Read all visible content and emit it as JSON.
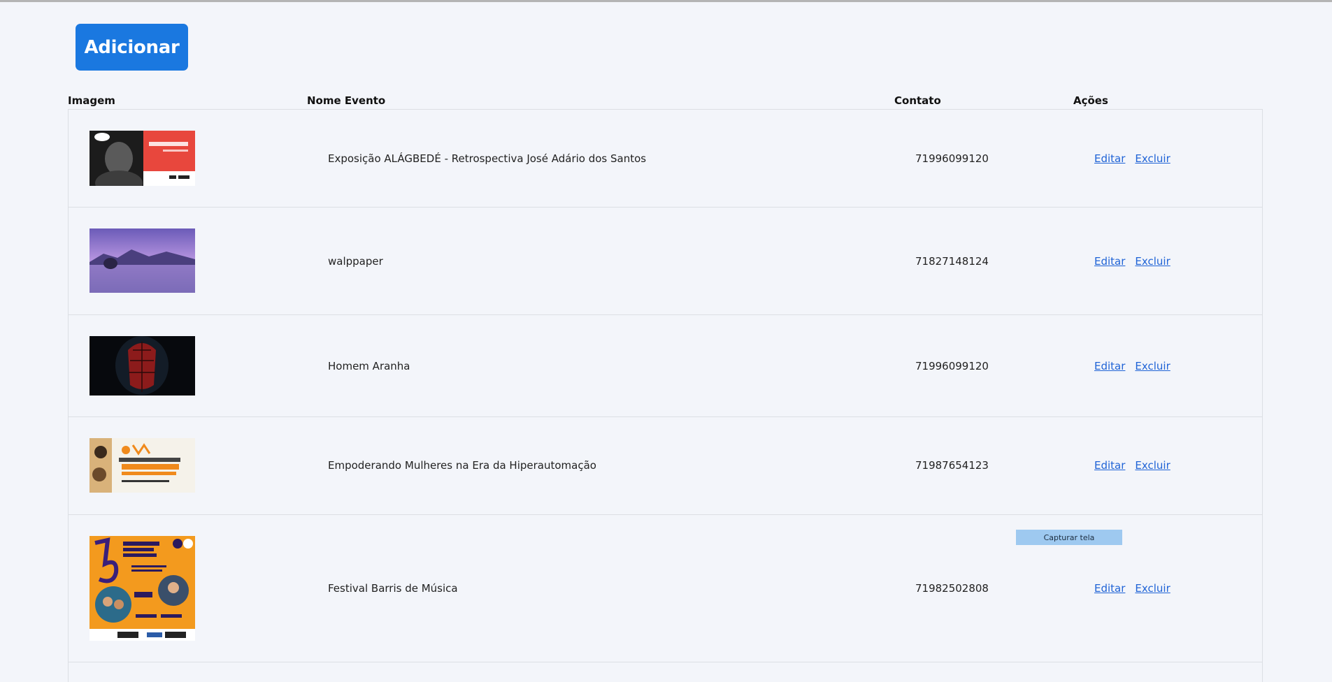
{
  "toolbar": {
    "add_label": "Adicionar"
  },
  "table": {
    "headers": [
      "Imagem",
      "Nome Evento",
      "Contato",
      "Ações"
    ],
    "rows": [
      {
        "name": "Exposição ALÁGBEDÉ - Retrospectiva José Adário dos Santos",
        "contact": "71996099120",
        "edit": "Editar",
        "delete": "Excluir"
      },
      {
        "name": "walppaper",
        "contact": "71827148124",
        "edit": "Editar",
        "delete": "Excluir"
      },
      {
        "name": "Homem Aranha",
        "contact": "71996099120",
        "edit": "Editar",
        "delete": "Excluir"
      },
      {
        "name": "Empoderando Mulheres na Era da Hiperautomação",
        "contact": "71987654123",
        "edit": "Editar",
        "delete": "Excluir"
      },
      {
        "name": "Festival Barris de Música",
        "contact": "71982502808",
        "edit": "Editar",
        "delete": "Excluir"
      }
    ]
  },
  "overlay": {
    "capture_label": "Capturar tela"
  },
  "colors": {
    "primary": "#1a78e0",
    "link": "#1f63d6",
    "background": "#f3f5fa",
    "capture": "#9ec9f0"
  }
}
